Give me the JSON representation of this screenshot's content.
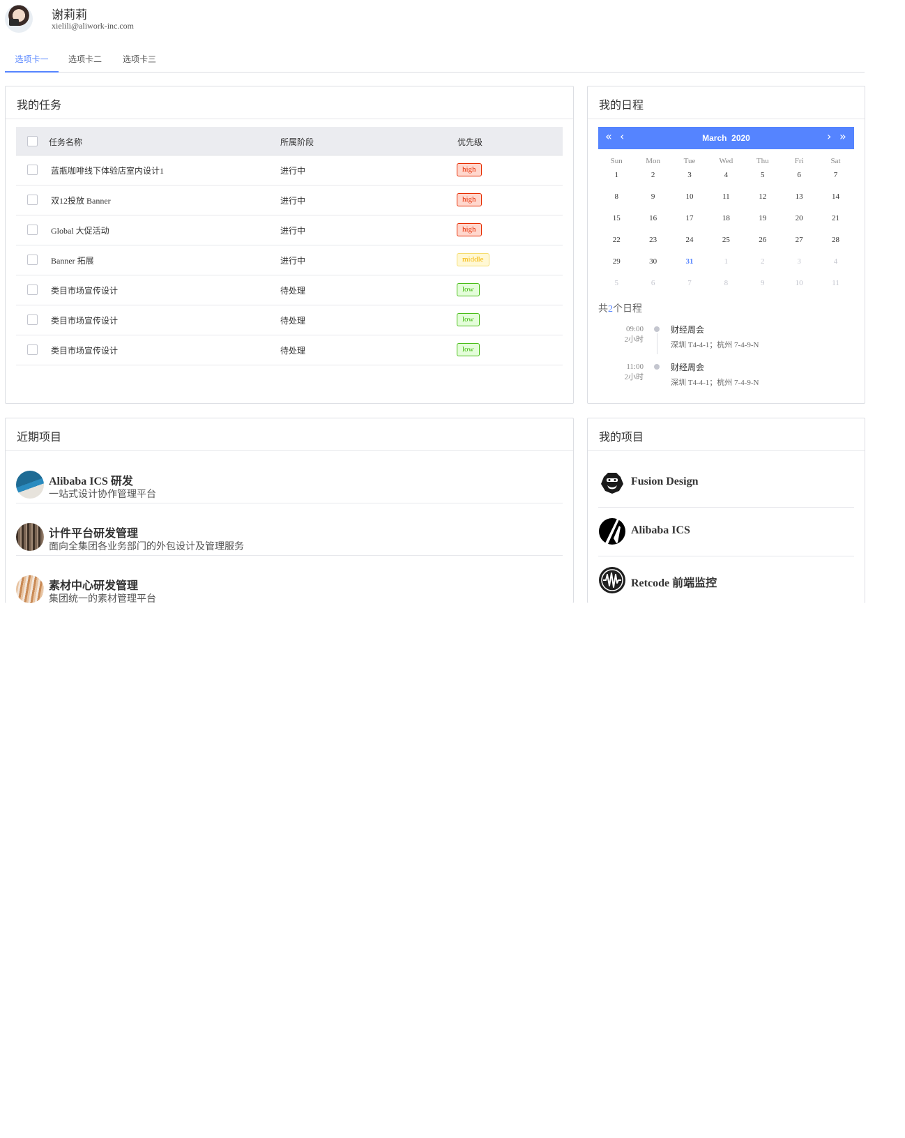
{
  "user": {
    "name": "谢莉莉",
    "email": "xielili@aliwork-inc.com"
  },
  "tabs": [
    {
      "label": "选项卡一",
      "active": true
    },
    {
      "label": "选项卡二",
      "active": false
    },
    {
      "label": "选项卡三",
      "active": false
    }
  ],
  "tasks": {
    "title": "我的任务",
    "columns": [
      "任务名称",
      "所属阶段",
      "优先级"
    ],
    "rows": [
      {
        "name": "蓝瓶咖啡线下体验店室内设计1",
        "stage": "进行中",
        "priority": "high"
      },
      {
        "name": "双12投放 Banner",
        "stage": "进行中",
        "priority": "high"
      },
      {
        "name": "Global 大促活动",
        "stage": "进行中",
        "priority": "high"
      },
      {
        "name": "Banner 拓展",
        "stage": "进行中",
        "priority": "middle"
      },
      {
        "name": "类目市场宣传设计",
        "stage": "待处理",
        "priority": "low"
      },
      {
        "name": "类目市场宣传设计",
        "stage": "待处理",
        "priority": "low"
      },
      {
        "name": "类目市场宣传设计",
        "stage": "待处理",
        "priority": "low"
      }
    ],
    "priority_colors": {
      "high": "#e72b00",
      "middle": "#f5b600",
      "low": "#46bc15"
    }
  },
  "schedule": {
    "title": "我的日程",
    "calendar": {
      "month_label": "March",
      "year_label": "2020",
      "nav": {
        "prev_year": "«",
        "prev_month": "‹",
        "next_month": "›",
        "next_year": "»"
      },
      "weekdays": [
        "Sun",
        "Mon",
        "Tue",
        "Wed",
        "Thu",
        "Fri",
        "Sat"
      ],
      "weeks": [
        [
          {
            "d": "1"
          },
          {
            "d": "2"
          },
          {
            "d": "3"
          },
          {
            "d": "4"
          },
          {
            "d": "5"
          },
          {
            "d": "6"
          },
          {
            "d": "7"
          }
        ],
        [
          {
            "d": "8"
          },
          {
            "d": "9"
          },
          {
            "d": "10"
          },
          {
            "d": "11"
          },
          {
            "d": "12"
          },
          {
            "d": "13"
          },
          {
            "d": "14"
          }
        ],
        [
          {
            "d": "15"
          },
          {
            "d": "16"
          },
          {
            "d": "17"
          },
          {
            "d": "18"
          },
          {
            "d": "19"
          },
          {
            "d": "20"
          },
          {
            "d": "21"
          }
        ],
        [
          {
            "d": "22"
          },
          {
            "d": "23"
          },
          {
            "d": "24"
          },
          {
            "d": "25"
          },
          {
            "d": "26"
          },
          {
            "d": "27"
          },
          {
            "d": "28"
          }
        ],
        [
          {
            "d": "29"
          },
          {
            "d": "30"
          },
          {
            "d": "31",
            "today": true
          },
          {
            "d": "1",
            "muted": true
          },
          {
            "d": "2",
            "muted": true
          },
          {
            "d": "3",
            "muted": true
          },
          {
            "d": "4",
            "muted": true
          }
        ],
        [
          {
            "d": "5",
            "muted": true
          },
          {
            "d": "6",
            "muted": true
          },
          {
            "d": "7",
            "muted": true
          },
          {
            "d": "8",
            "muted": true
          },
          {
            "d": "9",
            "muted": true
          },
          {
            "d": "10",
            "muted": true
          },
          {
            "d": "11",
            "muted": true
          }
        ]
      ],
      "accent_color": "#5584ff"
    },
    "count_prefix": "共",
    "count": "2",
    "count_suffix": "个日程",
    "items": [
      {
        "time": "09:00",
        "duration": "2小时",
        "title": "财经周会",
        "location": "深圳 T4-4-1；杭州 7-4-9-N"
      },
      {
        "time": "11:00",
        "duration": "2小时",
        "title": "财经周会",
        "location": "深圳 T4-4-1；杭州 7-4-9-N"
      }
    ]
  },
  "recent_projects": {
    "title": "近期项目",
    "items": [
      {
        "name": "Alibaba ICS 研发",
        "desc": "一站式设计协作管理平台"
      },
      {
        "name": "计件平台研发管理",
        "desc": "面向全集团各业务部门的外包设计及管理服务"
      },
      {
        "name": "素材中心研发管理",
        "desc": "集团统一的素材管理平台"
      }
    ]
  },
  "my_projects": {
    "title": "我的项目",
    "items": [
      {
        "name": "Fusion Design",
        "icon": "gorilla-logo-icon"
      },
      {
        "name": "Alibaba ICS",
        "icon": "ics-logo-icon"
      },
      {
        "name": "Retcode 前端监控",
        "icon": "retcode-logo-icon"
      }
    ]
  }
}
